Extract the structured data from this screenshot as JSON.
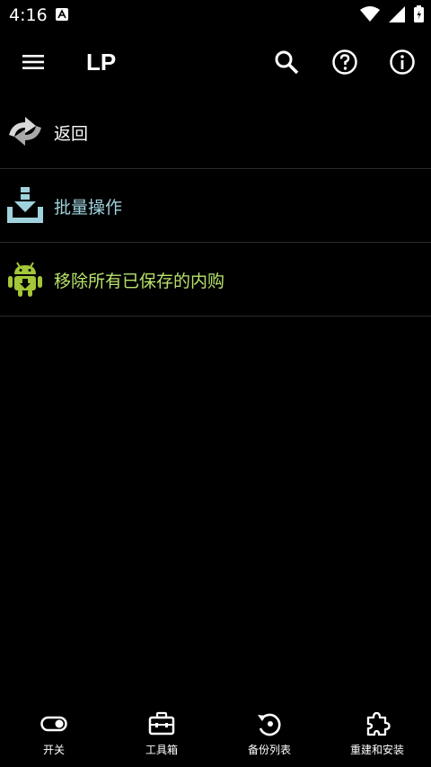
{
  "status": {
    "time": "4:16"
  },
  "appbar": {
    "title": "LP"
  },
  "menu_items": [
    {
      "label": "返回",
      "color": "#ffffff",
      "icon": "back-arrows-icon"
    },
    {
      "label": "批量操作",
      "color": "#9fd2dc",
      "icon": "download-tray-icon"
    },
    {
      "label": "移除所有已保存的内购",
      "color": "#b8e36a",
      "icon": "android-icon"
    }
  ],
  "bottom_nav": [
    {
      "label": "开关",
      "icon": "toggle-icon"
    },
    {
      "label": "工具箱",
      "icon": "toolbox-icon"
    },
    {
      "label": "备份列表",
      "icon": "backup-icon"
    },
    {
      "label": "重建和安装",
      "icon": "puzzle-icon"
    }
  ]
}
